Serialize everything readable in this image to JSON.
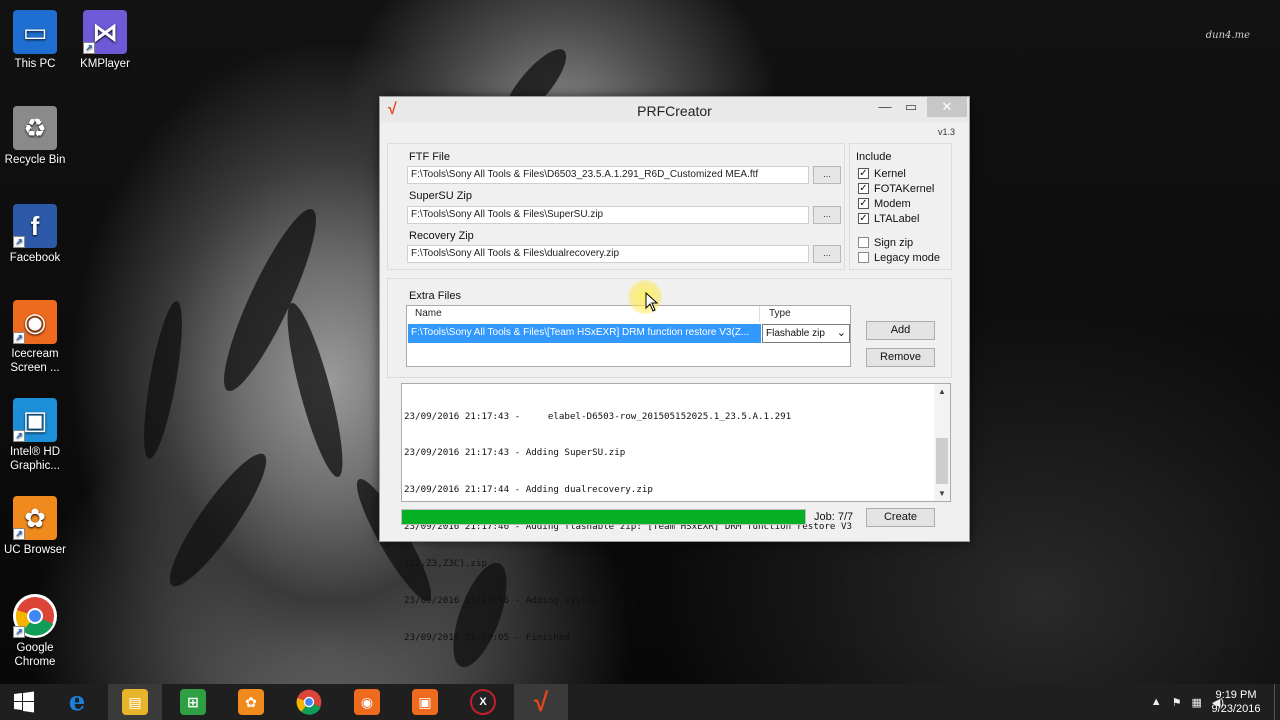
{
  "watermark": "dun4.me",
  "desktop": {
    "icons": [
      {
        "label": "This PC",
        "icon": "this-pc-icon",
        "color": "#1e6fd1"
      },
      {
        "label": "KMPlayer",
        "icon": "kmplayer-icon",
        "color": "#6e5ad6"
      },
      {
        "label": "Recycle Bin",
        "icon": "recycle-bin-icon",
        "color": "#8a8a8a"
      },
      {
        "label": "Facebook",
        "icon": "facebook-icon",
        "color": "#2d5aa8"
      },
      {
        "label": "Icecream Screen ...",
        "icon": "icecream-screen-icon",
        "color": "#ee6a1f"
      },
      {
        "label": "Intel® HD Graphic...",
        "icon": "intel-hd-graphics-icon",
        "color": "#1c8fd8"
      },
      {
        "label": "UC Browser",
        "icon": "uc-browser-icon",
        "color": "#f08a1c"
      },
      {
        "label": "Google Chrome",
        "icon": "google-chrome-icon",
        "color": "#3aa14a"
      }
    ]
  },
  "window": {
    "title": "PRFCreator",
    "version": "v1.3",
    "ftf_label": "FTF File",
    "ftf_value": "F:\\Tools\\Sony All Tools & Files\\D6503_23.5.A.1.291_R6D_Customized MEA.ftf",
    "supersu_label": "SuperSU Zip",
    "supersu_value": "F:\\Tools\\Sony All Tools & Files\\SuperSU.zip",
    "recovery_label": "Recovery Zip",
    "recovery_value": "F:\\Tools\\Sony All Tools & Files\\dualrecovery.zip",
    "browse_label": "...",
    "include": {
      "title": "Include",
      "options": [
        {
          "label": "Kernel",
          "checked": true
        },
        {
          "label": "FOTAKernel",
          "checked": true
        },
        {
          "label": "Modem",
          "checked": true
        },
        {
          "label": "LTALabel",
          "checked": true
        }
      ],
      "extra_options": [
        {
          "label": "Sign zip",
          "checked": false
        },
        {
          "label": "Legacy mode",
          "checked": false
        }
      ]
    },
    "extra_files": {
      "title": "Extra Files",
      "col_name": "Name",
      "col_type": "Type",
      "row_name": "F:\\Tools\\Sony All Tools & Files\\[Team HSxEXR] DRM function restore V3(Z...",
      "row_type": "Flashable zip",
      "add_label": "Add",
      "remove_label": "Remove"
    },
    "log": [
      "23/09/2016 21:17:43 -     elabel-D6503-row_201505152025.1_23.5.A.1.291",
      "23/09/2016 21:17:43 - Adding SuperSU.zip",
      "23/09/2016 21:17:44 - Adding dualrecovery.zip",
      "23/09/2016 21:17:46 - Adding flashable zip: [Team HSxEXR] DRM function restore V3",
      "(Z2,Z3,Z3C).zip",
      "23/09/2016 21:17:46 - Adding system to zip",
      "23/09/2016 21:19:05 - Finished"
    ],
    "progress": 1.0,
    "job_label": "Job: 7/7",
    "create_label": "Create",
    "accent_color": "#06b025"
  },
  "taskbar": {
    "items": [
      {
        "icon": "windows-start-icon",
        "color": "#1f1f1f"
      },
      {
        "icon": "internet-explorer-icon",
        "color": "#1c7fd8"
      },
      {
        "icon": "file-explorer-icon",
        "color": "#e8b52a"
      },
      {
        "icon": "windows-store-icon",
        "color": "#2ea043"
      },
      {
        "icon": "uc-browser-icon",
        "color": "#f08a1c"
      },
      {
        "icon": "google-chrome-icon",
        "color": "#3aa14a"
      },
      {
        "icon": "icecream-recorder-icon",
        "color": "#ee6a1f"
      },
      {
        "icon": "icecream-screenshot-icon",
        "color": "#ee6a1f"
      },
      {
        "icon": "xsplit-icon",
        "color": "#c21f2c"
      },
      {
        "icon": "prfcreator-icon",
        "color": "#e8461b"
      }
    ],
    "time": "9:19 PM",
    "date": "9/23/2016"
  }
}
